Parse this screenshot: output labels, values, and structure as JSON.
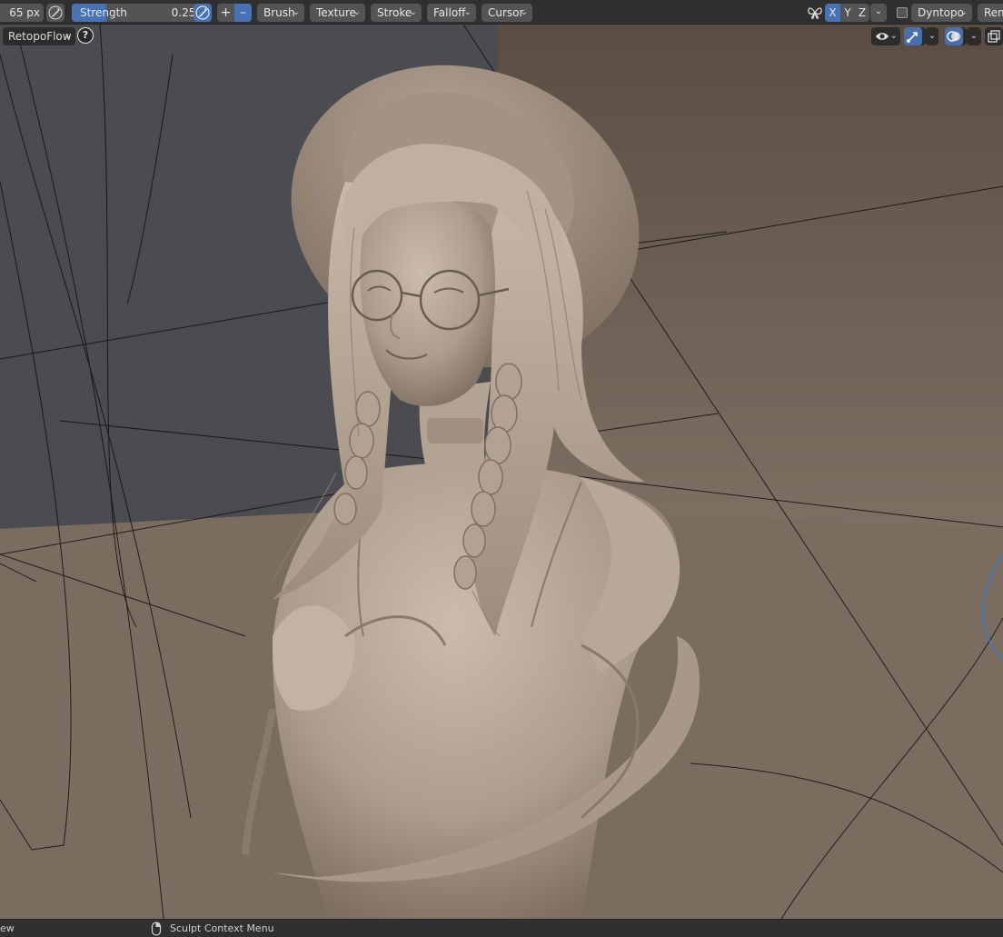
{
  "header": {
    "radius": "65 px",
    "strength_label": "Strength",
    "strength_value": "0.250",
    "strength_fraction": 0.25,
    "plus": "+",
    "minus": "–",
    "menus": [
      "Brush",
      "Texture",
      "Stroke",
      "Falloff",
      "Cursor"
    ],
    "axes": [
      "X",
      "Y",
      "Z"
    ],
    "dyntopo": "Dyntopo",
    "remesh": "Rem"
  },
  "overlay": {
    "retopoflow": "RetopoFlow",
    "help": "?"
  },
  "status": {
    "left_text": "ew",
    "context_menu": "Sculpt Context Menu"
  },
  "colors": {
    "accent": "#4772b3",
    "header_bg": "#303030",
    "button_bg": "#545454",
    "clay": "#b8a898",
    "backdrop_gray": "#4a4c50",
    "floor": "#7a6d60"
  },
  "icons": {
    "radius_pen": "pen-pressure-icon",
    "strength_pen": "pen-pressure-icon",
    "mirror": "butterfly-mirror-icon",
    "visibility": "eye-icon",
    "gizmo": "arrow-gizmo-icon",
    "overlays": "overlay-circles-icon",
    "xray": "xray-icon",
    "mouse": "mouse-icon"
  }
}
